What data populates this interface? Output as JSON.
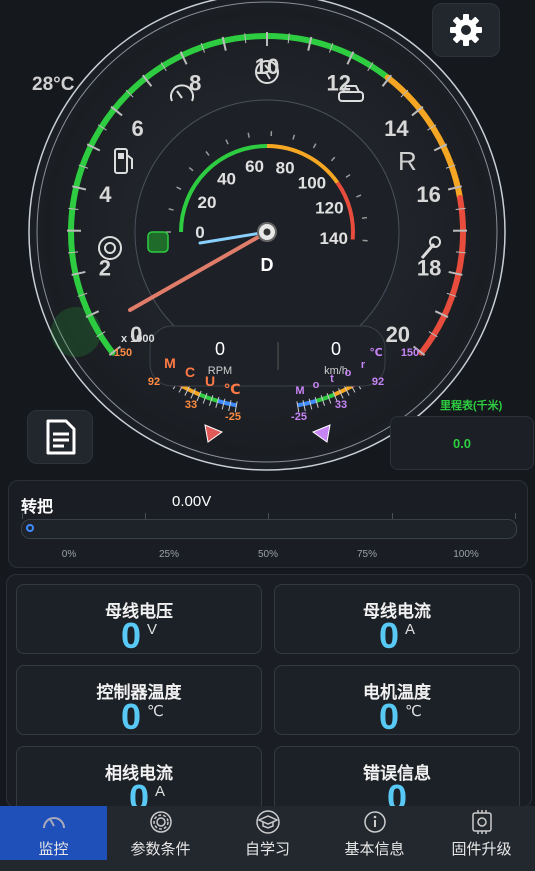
{
  "dashboard": {
    "temperature": "28°C",
    "gear": "D",
    "reverse": "R",
    "rpm_multiplier": "x 1000",
    "rpm_value": "0",
    "rpm_unit": "RPM",
    "speed_value": "0",
    "speed_unit": "km/h",
    "rpm_ticks": [
      "0",
      "2",
      "4",
      "6",
      "8",
      "10",
      "12",
      "14",
      "16",
      "18",
      "20"
    ],
    "speed_ticks": [
      "0",
      "20",
      "40",
      "60",
      "80",
      "100",
      "120",
      "140"
    ],
    "mcu_label": [
      "M",
      "C",
      "U",
      "℃"
    ],
    "motor_label": [
      "M",
      "o",
      "t",
      "o",
      "r",
      "℃"
    ],
    "mcu_temp_ticks": [
      "150",
      "92",
      "33",
      "-25"
    ],
    "motor_temp_ticks": [
      "150",
      "92",
      "33",
      "-25"
    ],
    "rpm_level": 0.0,
    "speed_level": 0.0,
    "colors": {
      "green": "#2ecc40",
      "orange": "#f5a623",
      "red": "#e74c3c",
      "blue": "#3d8bfd",
      "needle": "#e07d6a"
    }
  },
  "odometer": {
    "label": "里程表(千米)",
    "value": "0.0"
  },
  "throttle": {
    "title": "转把",
    "value": "0.00V",
    "level": 0.0,
    "ticks": [
      "0%",
      "25%",
      "50%",
      "75%",
      "100%"
    ]
  },
  "metrics": [
    {
      "title": "母线电压",
      "value": "0",
      "unit": "V"
    },
    {
      "title": "母线电流",
      "value": "0",
      "unit": "A"
    },
    {
      "title": "控制器温度",
      "value": "0",
      "unit": "℃"
    },
    {
      "title": "电机温度",
      "value": "0",
      "unit": "℃"
    },
    {
      "title": "相线电流",
      "value": "0",
      "unit": "A"
    },
    {
      "title": "错误信息",
      "value": "0",
      "unit": ""
    }
  ],
  "nav": [
    {
      "label": "监控",
      "icon": "gauge-icon",
      "active": true
    },
    {
      "label": "参数条件",
      "icon": "gear-icon",
      "active": false
    },
    {
      "label": "自学习",
      "icon": "graduation-cap-icon",
      "active": false
    },
    {
      "label": "基本信息",
      "icon": "info-icon",
      "active": false
    },
    {
      "label": "固件升级",
      "icon": "firmware-chip-icon",
      "active": false
    }
  ]
}
